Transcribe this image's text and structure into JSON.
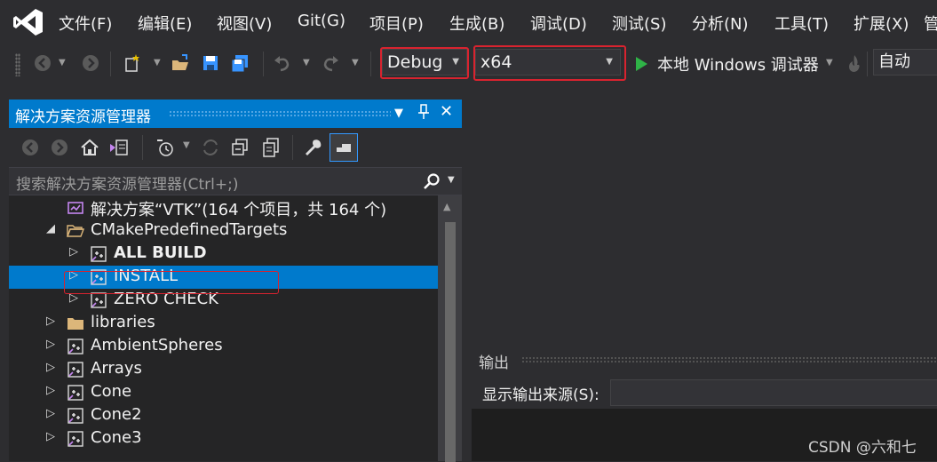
{
  "menu": {
    "items": [
      "文件(F)",
      "编辑(E)",
      "视图(V)",
      "Git(G)",
      "项目(P)",
      "生成(B)",
      "调试(D)",
      "测试(S)",
      "分析(N)",
      "工具(T)",
      "扩展(X)"
    ]
  },
  "toolbar": {
    "configuration": "Debug",
    "platform": "x64",
    "debugger_target": "本地 Windows 调试器",
    "mode": "自动"
  },
  "solution_explorer": {
    "title": "解决方案资源管理器",
    "search_placeholder": "搜索解决方案资源管理器(Ctrl+;)",
    "tree": [
      {
        "label": "解决方案“VTK”(164 个项目，共 164 个)",
        "icon": "solution-icon",
        "expander": "",
        "bold": false,
        "selected": false
      },
      {
        "label": "CMakePredefinedTargets",
        "icon": "folder-open-icon",
        "expander": "expanded",
        "bold": false,
        "selected": false
      },
      {
        "label": "ALL BUILD",
        "icon": "cmake-project-icon",
        "expander": "collapsed",
        "bold": true,
        "selected": false
      },
      {
        "label": "INSTALL",
        "icon": "cmake-project-icon",
        "expander": "collapsed",
        "bold": false,
        "selected": true
      },
      {
        "label": "ZERO CHECK",
        "icon": "cmake-project-icon",
        "expander": "collapsed",
        "bold": false,
        "selected": false
      },
      {
        "label": "libraries",
        "icon": "folder-icon",
        "expander": "collapsed",
        "bold": false,
        "selected": false
      },
      {
        "label": "AmbientSpheres",
        "icon": "cmake-project-icon",
        "expander": "collapsed",
        "bold": false,
        "selected": false
      },
      {
        "label": "Arrays",
        "icon": "cmake-project-icon",
        "expander": "collapsed",
        "bold": false,
        "selected": false
      },
      {
        "label": "Cone",
        "icon": "cmake-project-icon",
        "expander": "collapsed",
        "bold": false,
        "selected": false
      },
      {
        "label": "Cone2",
        "icon": "cmake-project-icon",
        "expander": "collapsed",
        "bold": false,
        "selected": false
      },
      {
        "label": "Cone3",
        "icon": "cmake-project-icon",
        "expander": "collapsed",
        "bold": false,
        "selected": false
      }
    ]
  },
  "output": {
    "title": "输出",
    "source_label": "显示输出来源(S):",
    "source_value": ""
  },
  "watermark": "CSDN @六和七",
  "colors": {
    "accent": "#007acc",
    "highlight_box": "#d9232f",
    "folder": "#dcb67a",
    "vs_purple": "#c586f0",
    "run_green": "#2fb347"
  }
}
